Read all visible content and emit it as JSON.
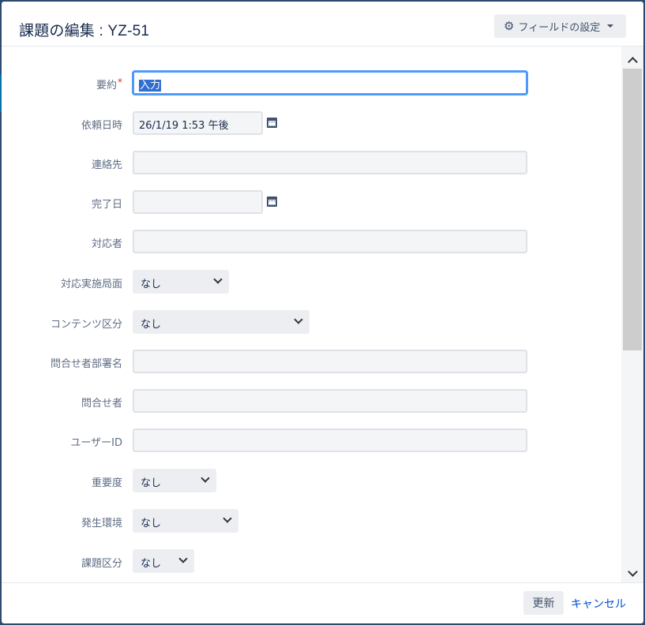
{
  "dialog": {
    "title": "課題の編集 : YZ-51",
    "config_button": "フィールドの設定",
    "update_button": "更新",
    "cancel_link": "キャンセル"
  },
  "fields": {
    "summary": {
      "label": "要約",
      "required_mark": "*",
      "value": "入力"
    },
    "request_date": {
      "label": "依頼日時",
      "value": "26/1/19 1:53 午後"
    },
    "contact": {
      "label": "連絡先",
      "value": ""
    },
    "due_date": {
      "label": "完了日",
      "value": ""
    },
    "assignee": {
      "label": "対応者",
      "value": ""
    },
    "handling_dept": {
      "label": "対応実施局面",
      "value": "なし"
    },
    "content_type": {
      "label": "コンテンツ区分",
      "value": "なし"
    },
    "inquirer_dept": {
      "label": "問合せ者部署名",
      "value": ""
    },
    "inquirer": {
      "label": "問合せ者",
      "value": ""
    },
    "user_id": {
      "label": "ユーザーID",
      "value": ""
    },
    "severity": {
      "label": "重要度",
      "value": "なし"
    },
    "environment": {
      "label": "発生環境",
      "value": "なし"
    },
    "issue_type": {
      "label": "課題区分",
      "value": "なし"
    }
  },
  "icons": [
    "gear-icon",
    "calendar-icon",
    "chevron-down-icon",
    "scroll-up-icon",
    "scroll-down-icon"
  ],
  "colors": {
    "accent": "#4c9aff",
    "link": "#0052cc",
    "required": "#de350b"
  }
}
